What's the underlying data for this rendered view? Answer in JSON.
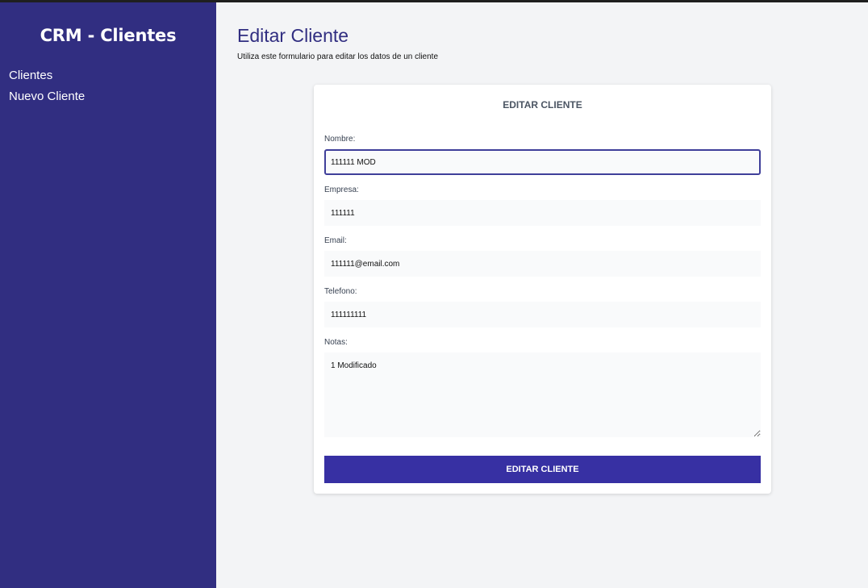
{
  "sidebar": {
    "brand": "CRM - Clientes",
    "items": [
      {
        "label": "Clientes"
      },
      {
        "label": "Nuevo Cliente"
      }
    ]
  },
  "main": {
    "title": "Editar Cliente",
    "subtitle": "Utiliza este formulario para editar los datos de un cliente"
  },
  "form": {
    "heading": "EDITAR CLIENTE",
    "fields": {
      "nombre": {
        "label": "Nombre:",
        "value": "111111 MOD"
      },
      "empresa": {
        "label": "Empresa:",
        "value": "111111"
      },
      "email": {
        "label": "Email:",
        "value": "111111@email.com"
      },
      "telefono": {
        "label": "Telefono:",
        "value": "111111111"
      },
      "notas": {
        "label": "Notas:",
        "value": "1 Modificado"
      }
    },
    "submit_label": "EDITAR CLIENTE"
  },
  "colors": {
    "sidebar_bg": "#312e81",
    "accent": "#3730a3",
    "page_bg": "#f3f4f6"
  }
}
